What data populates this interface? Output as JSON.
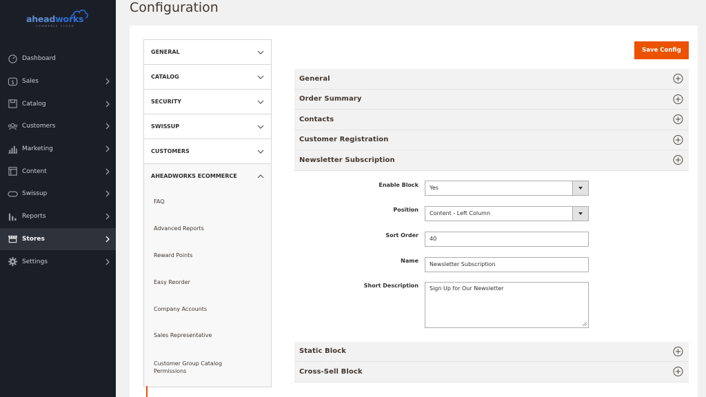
{
  "brand": {
    "logo_text_a": "ahead",
    "logo_text_b": "works",
    "logo_sub": "COMMERCE CLOUD"
  },
  "sidebar": {
    "items": [
      {
        "label": "Dashboard",
        "icon": "dashboard-icon"
      },
      {
        "label": "Sales",
        "icon": "dollar-icon"
      },
      {
        "label": "Catalog",
        "icon": "box-icon"
      },
      {
        "label": "Customers",
        "icon": "users-icon"
      },
      {
        "label": "Marketing",
        "icon": "bar-chart-icon"
      },
      {
        "label": "Content",
        "icon": "layout-icon"
      },
      {
        "label": "Swissup",
        "icon": "swissup-icon"
      },
      {
        "label": "Reports",
        "icon": "reports-icon"
      },
      {
        "label": "Stores",
        "icon": "store-icon"
      },
      {
        "label": "Settings",
        "icon": "gear-icon"
      }
    ]
  },
  "page": {
    "title": "Configuration"
  },
  "toolbar": {
    "save_label": "Save Config"
  },
  "config_tabs": {
    "headers": [
      "GENERAL",
      "CATALOG",
      "SECURITY",
      "SWISSUP",
      "CUSTOMERS",
      "AHEADWORKS ECOMMERCE"
    ],
    "open_items": [
      "FAQ",
      "Advanced Reports",
      "Reward Points",
      "Easy Reorder",
      "Company Accounts",
      "Sales Representative",
      "Customer Group Catalog Permissions"
    ]
  },
  "sections": {
    "top": [
      "General",
      "Order Summary",
      "Contacts",
      "Customer Registration",
      "Newsletter Subscription"
    ],
    "bottom": [
      "Static Block",
      "Cross-Sell Block"
    ]
  },
  "form": {
    "enable_block": {
      "label": "Enable Block",
      "value": "Yes"
    },
    "position": {
      "label": "Position",
      "value": "Content - Left Column"
    },
    "sort_order": {
      "label": "Sort Order",
      "value": "40"
    },
    "name": {
      "label": "Name",
      "value": "Newsletter Subscription"
    },
    "short_description": {
      "label": "Short Description",
      "value": "Sign Up for Our Newsletter"
    }
  },
  "colors": {
    "sidebar_bg": "#1a1e27",
    "accent": "#eb5202",
    "logo_blue": "#2c6fd6"
  }
}
